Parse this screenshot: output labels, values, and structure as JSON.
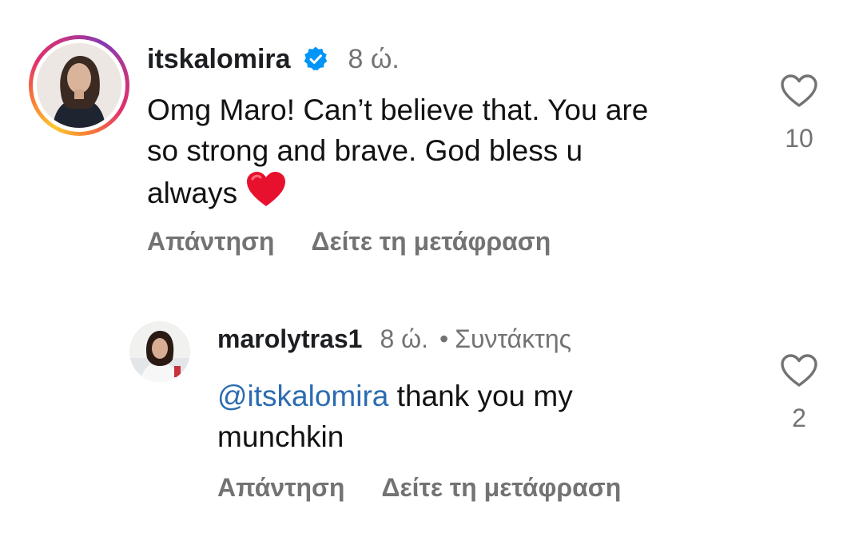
{
  "comments": [
    {
      "username": "itskalomira",
      "verified": true,
      "time": "8 ώ.",
      "text_line1": "Omg Maro! Can’t believe that. You are",
      "text_line2": "so strong and brave. God bless u",
      "text_line3": "always",
      "emoji": "red-heart-emoji",
      "likes": "10",
      "reply_label": "Απάντηση",
      "translate_label": "Δείτε τη μετάφραση"
    },
    {
      "username": "marolytras1",
      "time": "8 ώ.",
      "separator": "•",
      "role": "Συντάκτης",
      "mention": "@itskalomira",
      "text_line1": "thank you my",
      "text_line2": "munchkin",
      "likes": "2",
      "reply_label": "Απάντηση",
      "translate_label": "Δείτε τη μετάφραση"
    }
  ],
  "icons": {
    "verified": "verified-badge-icon",
    "like": "heart-outline-icon"
  },
  "colors": {
    "verified_blue": "#0095f6",
    "mention_blue": "#2b6cb0",
    "muted_gray": "#737373",
    "heart_red": "#e0245e"
  }
}
